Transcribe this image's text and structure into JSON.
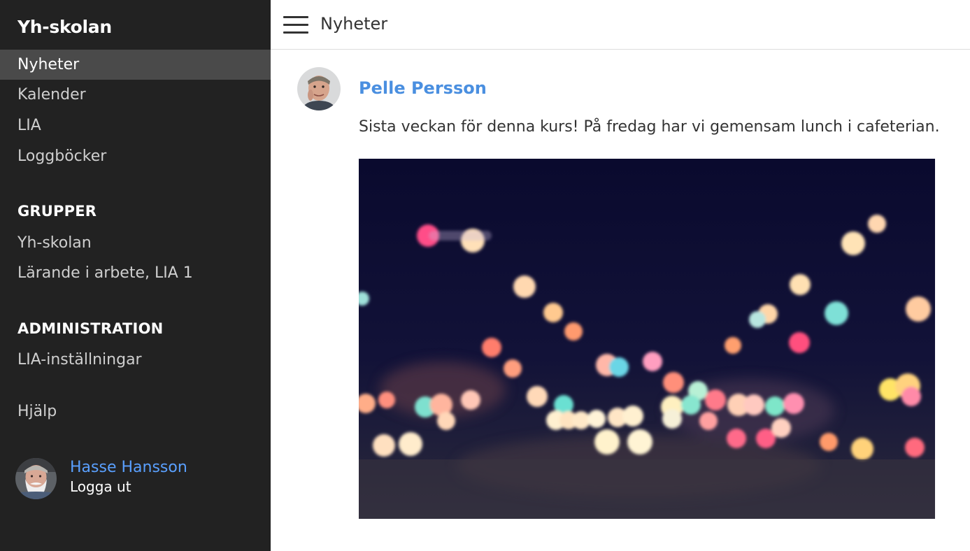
{
  "sidebar": {
    "brand": "Yh-skolan",
    "nav": [
      {
        "label": "Nyheter",
        "active": true
      },
      {
        "label": "Kalender"
      },
      {
        "label": "LIA"
      },
      {
        "label": "Loggböcker"
      }
    ],
    "groups_heading": "GRUPPER",
    "groups": [
      {
        "label": "Yh-skolan"
      },
      {
        "label": "Lärande i arbete, LIA 1"
      }
    ],
    "admin_heading": "ADMINISTRATION",
    "admin": [
      {
        "label": "LIA-inställningar"
      }
    ],
    "help": "Hjälp",
    "user": {
      "name": "Hasse Hansson",
      "logout": "Logga ut"
    }
  },
  "topbar": {
    "title": "Nyheter",
    "menu_icon": "hamburger-menu-icon"
  },
  "post": {
    "author": "Pelle Persson",
    "text": "Sista veckan för denna kurs! På fredag har vi gemensam lunch i cafeterian."
  },
  "colors": {
    "sidebar_bg": "#222222",
    "active_bg": "#4a4a4a",
    "link_blue": "#4a8fe0",
    "image_bg": "#0d0d30"
  }
}
